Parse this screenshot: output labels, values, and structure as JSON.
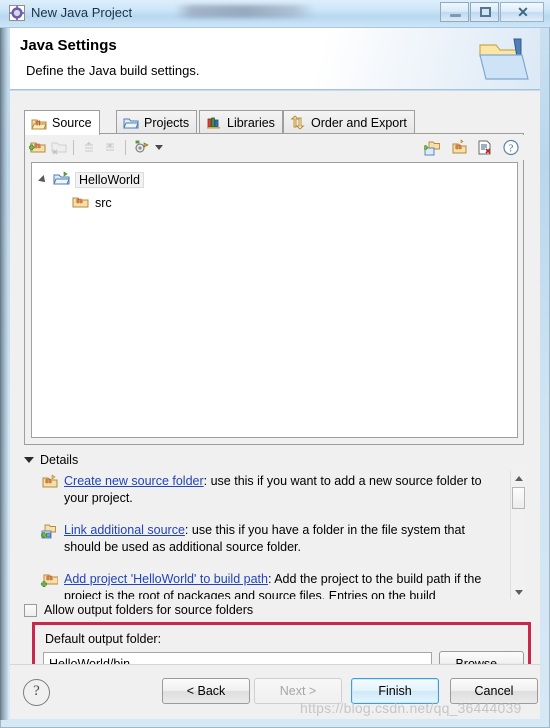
{
  "window": {
    "title": "New Java Project",
    "icon": "java-project-window-icon",
    "controls": {
      "minimize": "minimize-icon",
      "maximize": "maximize-icon",
      "close": "✕"
    }
  },
  "header": {
    "title": "Java Settings",
    "description": "Define the Java build settings.",
    "icon": "java-project-folder-banner-icon"
  },
  "tabs": [
    {
      "label": "Source",
      "icon": "source-folder-icon",
      "active": true
    },
    {
      "label": "Projects",
      "icon": "projects-folder-icon",
      "active": false
    },
    {
      "label": "Libraries",
      "icon": "libraries-books-icon",
      "active": false
    },
    {
      "label": "Order and Export",
      "icon": "order-export-arrows-icon",
      "active": false
    }
  ],
  "source_toolbar": {
    "left": [
      {
        "name": "add-folder-icon",
        "enabled": true
      },
      {
        "name": "remove-folder-icon",
        "enabled": false
      },
      {
        "name": "move-up-icon",
        "enabled": false
      },
      {
        "name": "move-down-icon",
        "enabled": false
      },
      {
        "name": "configure-icon",
        "enabled": true
      },
      {
        "name": "dropdown-caret-icon",
        "enabled": true
      }
    ],
    "right": [
      {
        "name": "link-source-icon",
        "enabled": true
      },
      {
        "name": "create-source-folder-icon",
        "enabled": true
      },
      {
        "name": "remove-entry-icon",
        "enabled": true
      },
      {
        "name": "help-circle-icon",
        "enabled": true
      }
    ]
  },
  "tree": {
    "root": {
      "label": "HelloWorld",
      "icon": "project-folder-icon",
      "expanded": true,
      "selected": true
    },
    "children": [
      {
        "label": "src",
        "icon": "source-folder-icon"
      }
    ]
  },
  "details": {
    "section_label": "Details",
    "items": [
      {
        "icon": "create-new-source-folder-icon",
        "link": "Create new source folder",
        "text": ": use this if you want to add a new source folder to your project."
      },
      {
        "icon": "link-additional-source-icon",
        "link": "Link additional source",
        "text": ": use this if you have a folder in the file system that should be used as additional source folder."
      },
      {
        "icon": "add-project-to-build-path-icon",
        "link": "Add project 'HelloWorld' to build path",
        "text": ": Add the project to the build path if the project is the root of packages and source files. Entries on the build"
      }
    ]
  },
  "allow_output_folders": {
    "label": "Allow output folders for source folders",
    "checked": false
  },
  "default_output": {
    "label": "Default output folder:",
    "value": "HelloWorld/bin",
    "placeholder": "",
    "browse_label": "Browse...",
    "highlight_color": "#c8284c"
  },
  "footer": {
    "help": "?",
    "buttons": [
      {
        "id": "back",
        "label": "< Back",
        "enabled": true,
        "default": false
      },
      {
        "id": "next",
        "label": "Next >",
        "enabled": false,
        "default": false
      },
      {
        "id": "finish",
        "label": "Finish",
        "enabled": true,
        "default": true
      },
      {
        "id": "cancel",
        "label": "Cancel",
        "enabled": true,
        "default": false
      }
    ]
  },
  "watermark": "https://blog.csdn.net/qq_36444039"
}
